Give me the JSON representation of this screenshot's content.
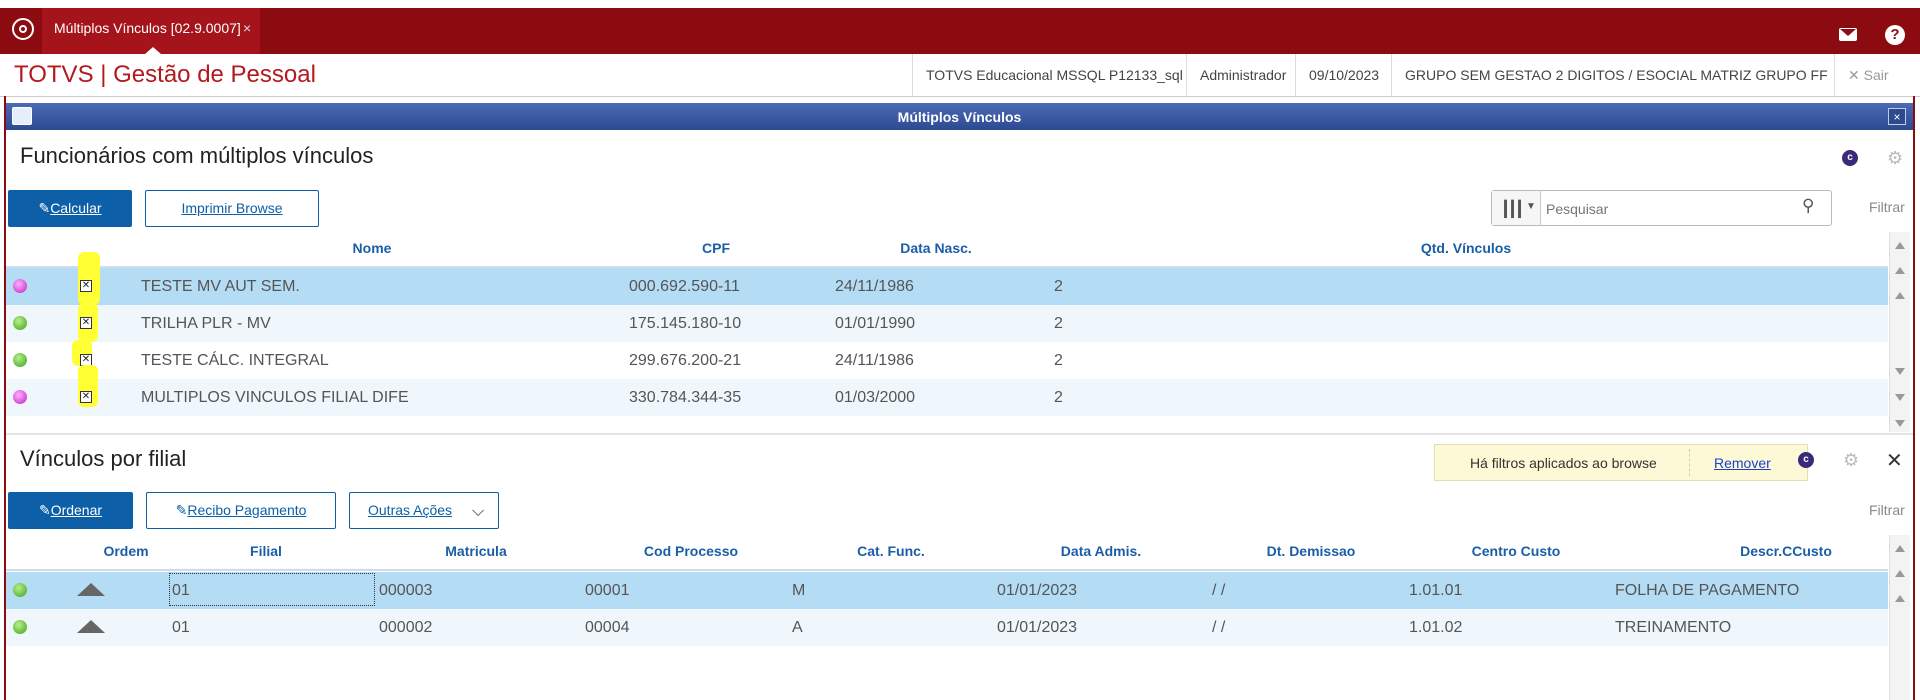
{
  "tabbar": {
    "tab_label": "Múltiplos Vínculos [02.9.0007]",
    "tab_close": "×",
    "logo_icon": "totvs-logo-icon",
    "mail_icon": "mail-icon",
    "help_icon": "?"
  },
  "header": {
    "title": "TOTVS | Gestão de Pessoal",
    "environment": "TOTVS Educacional MSSQL P12133_sql",
    "user": "Administrador",
    "date": "09/10/2023",
    "company": "GRUPO SEM GESTAO 2 DIGITOS / ESOCIAL MATRIZ GRUPO FF",
    "exit_label": "Sair",
    "exit_icon": "✕"
  },
  "window": {
    "title": "Múltiplos Vínculos",
    "close": "×"
  },
  "section1": {
    "title": "Funcionários com múltiplos vínculos",
    "calc_button": "Calcular",
    "print_button": "Imprimir Browse",
    "search_placeholder": "Pesquisar",
    "filter_label": "Filtrar",
    "columns": [
      "Nome",
      "CPF",
      "Data Nasc.",
      "Qtd. Vínculos"
    ],
    "rows": [
      {
        "status": "magenta",
        "checked": true,
        "nome": "TESTE MV AUT SEM.",
        "cpf": "000.692.590-11",
        "data_nasc": "24/11/1986",
        "qtd": "2"
      },
      {
        "status": "green",
        "checked": true,
        "nome": "TRILHA PLR - MV",
        "cpf": "175.145.180-10",
        "data_nasc": "01/01/1990",
        "qtd": "2"
      },
      {
        "status": "green",
        "checked": true,
        "nome": "TESTE CÁLC. INTEGRAL",
        "cpf": "299.676.200-21",
        "data_nasc": "24/11/1986",
        "qtd": "2"
      },
      {
        "status": "magenta",
        "checked": true,
        "nome": "MULTIPLOS VINCULOS FILIAL DIFE",
        "cpf": "330.784.344-35",
        "data_nasc": "01/03/2000",
        "qtd": "2"
      }
    ]
  },
  "section2": {
    "title": "Vínculos por filial",
    "filter_notice": "Há filtros aplicados ao browse",
    "remove_label": "Remover",
    "order_button": "Ordenar",
    "receipt_button": "Recibo Pagamento",
    "other_actions": "Outras Ações",
    "filter_label": "Filtrar",
    "close": "✕",
    "columns": [
      "Ordem",
      "Filial",
      "Matricula",
      "Cod Processo",
      "Cat. Func.",
      "Data Admis.",
      "Dt. Demissao",
      "Centro Custo",
      "Descr.CCusto"
    ],
    "rows": [
      {
        "status": "green",
        "filial": "01",
        "matricula": "000003",
        "cod_processo": "00001",
        "cat_func": "M",
        "data_admis": "01/01/2023",
        "dt_demissao": "/ /",
        "centro_custo": "1.01.01",
        "descr": "FOLHA DE PAGAMENTO"
      },
      {
        "status": "green",
        "filial": "01",
        "matricula": "000002",
        "cod_processo": "00004",
        "cat_func": "A",
        "data_admis": "01/01/2023",
        "dt_demissao": "/ /",
        "centro_custo": "1.01.02",
        "descr": "TREINAMENTO"
      }
    ]
  },
  "colors": {
    "brand": "#8b0b10",
    "title_red": "#b3191e",
    "primary": "#0d5fa8",
    "selected_row": "#b4dcf4"
  }
}
